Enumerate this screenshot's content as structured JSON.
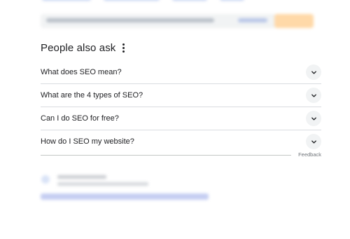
{
  "paa": {
    "title": "People also ask",
    "questions": [
      {
        "text": "What does SEO mean?"
      },
      {
        "text": "What are the 4 types of SEO?"
      },
      {
        "text": "Can I do SEO for free?"
      },
      {
        "text": "How do I SEO my website?"
      }
    ],
    "feedback_label": "Feedback"
  },
  "colors": {
    "text": "#202124",
    "chevron_bg": "#f1f3f4",
    "divider": "#dadce0",
    "muted": "#70757a"
  },
  "icons": {
    "more": "three-dots-vertical-icon",
    "expand": "chevron-down-icon"
  }
}
